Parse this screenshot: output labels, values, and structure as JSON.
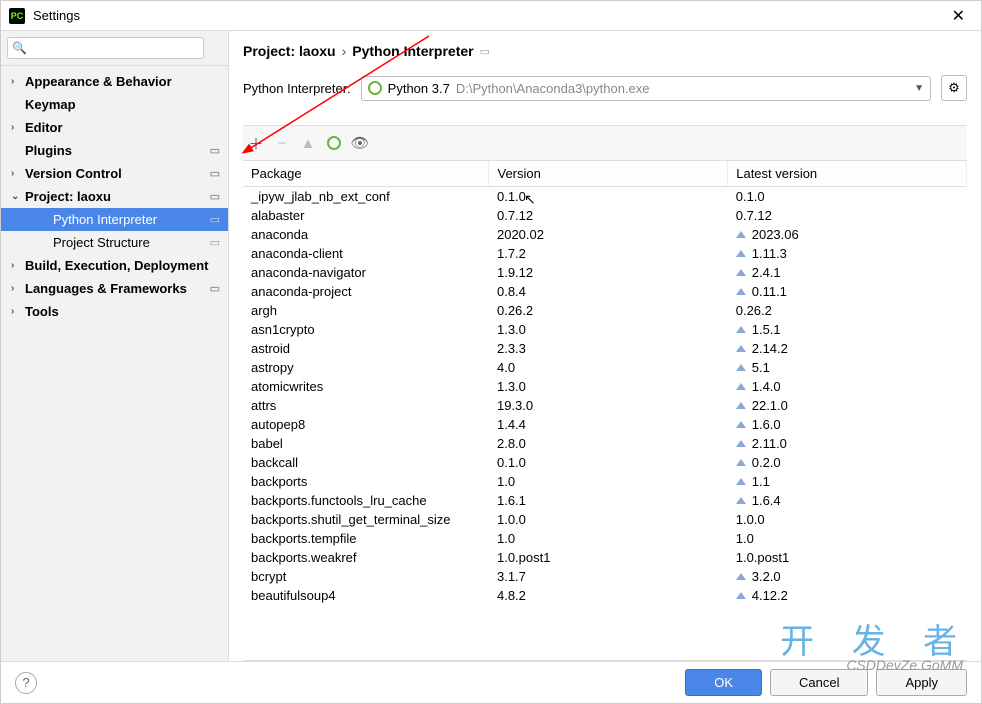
{
  "window": {
    "title": "Settings"
  },
  "search": {
    "placeholder": ""
  },
  "sidebar": {
    "items": [
      {
        "label": "Appearance & Behavior",
        "expandable": true,
        "cog": false
      },
      {
        "label": "Keymap",
        "expandable": false,
        "cog": false
      },
      {
        "label": "Editor",
        "expandable": true,
        "cog": false
      },
      {
        "label": "Plugins",
        "expandable": false,
        "cog": true
      },
      {
        "label": "Version Control",
        "expandable": true,
        "cog": true
      },
      {
        "label": "Project: laoxu",
        "expandable": true,
        "expanded": true,
        "cog": true
      },
      {
        "label": "Python Interpreter",
        "sub": true,
        "selected": true,
        "cog": true
      },
      {
        "label": "Project Structure",
        "sub": true,
        "cog": true
      },
      {
        "label": "Build, Execution, Deployment",
        "expandable": true
      },
      {
        "label": "Languages & Frameworks",
        "expandable": true,
        "cog": true
      },
      {
        "label": "Tools",
        "expandable": true
      }
    ]
  },
  "breadcrumb": {
    "project": "Project: laoxu",
    "page": "Python Interpreter"
  },
  "interpreter": {
    "label": "Python Interpreter:",
    "name": "Python 3.7",
    "path": "D:\\Python\\Anaconda3\\python.exe"
  },
  "table": {
    "headers": {
      "package": "Package",
      "version": "Version",
      "latest": "Latest version"
    },
    "rows": [
      {
        "pkg": "_ipyw_jlab_nb_ext_conf",
        "ver": "0.1.0",
        "latest": "0.1.0",
        "up": false
      },
      {
        "pkg": "alabaster",
        "ver": "0.7.12",
        "latest": "0.7.12",
        "up": false
      },
      {
        "pkg": "anaconda",
        "ver": "2020.02",
        "latest": "2023.06",
        "up": true
      },
      {
        "pkg": "anaconda-client",
        "ver": "1.7.2",
        "latest": "1.11.3",
        "up": true
      },
      {
        "pkg": "anaconda-navigator",
        "ver": "1.9.12",
        "latest": "2.4.1",
        "up": true
      },
      {
        "pkg": "anaconda-project",
        "ver": "0.8.4",
        "latest": "0.11.1",
        "up": true
      },
      {
        "pkg": "argh",
        "ver": "0.26.2",
        "latest": "0.26.2",
        "up": false
      },
      {
        "pkg": "asn1crypto",
        "ver": "1.3.0",
        "latest": "1.5.1",
        "up": true
      },
      {
        "pkg": "astroid",
        "ver": "2.3.3",
        "latest": "2.14.2",
        "up": true
      },
      {
        "pkg": "astropy",
        "ver": "4.0",
        "latest": "5.1",
        "up": true
      },
      {
        "pkg": "atomicwrites",
        "ver": "1.3.0",
        "latest": "1.4.0",
        "up": true
      },
      {
        "pkg": "attrs",
        "ver": "19.3.0",
        "latest": "22.1.0",
        "up": true
      },
      {
        "pkg": "autopep8",
        "ver": "1.4.4",
        "latest": "1.6.0",
        "up": true
      },
      {
        "pkg": "babel",
        "ver": "2.8.0",
        "latest": "2.11.0",
        "up": true
      },
      {
        "pkg": "backcall",
        "ver": "0.1.0",
        "latest": "0.2.0",
        "up": true
      },
      {
        "pkg": "backports",
        "ver": "1.0",
        "latest": "1.1",
        "up": true
      },
      {
        "pkg": "backports.functools_lru_cache",
        "ver": "1.6.1",
        "latest": "1.6.4",
        "up": true
      },
      {
        "pkg": "backports.shutil_get_terminal_size",
        "ver": "1.0.0",
        "latest": "1.0.0",
        "up": false
      },
      {
        "pkg": "backports.tempfile",
        "ver": "1.0",
        "latest": "1.0",
        "up": false
      },
      {
        "pkg": "backports.weakref",
        "ver": "1.0.post1",
        "latest": "1.0.post1",
        "up": false
      },
      {
        "pkg": "bcrypt",
        "ver": "3.1.7",
        "latest": "3.2.0",
        "up": true
      },
      {
        "pkg": "beautifulsoup4",
        "ver": "4.8.2",
        "latest": "4.12.2",
        "up": true
      }
    ]
  },
  "footer": {
    "ok": "OK",
    "cancel": "Cancel",
    "apply": "Apply"
  },
  "watermark": "开 发 者",
  "watermark2": "CSDDevZe.GoMM"
}
